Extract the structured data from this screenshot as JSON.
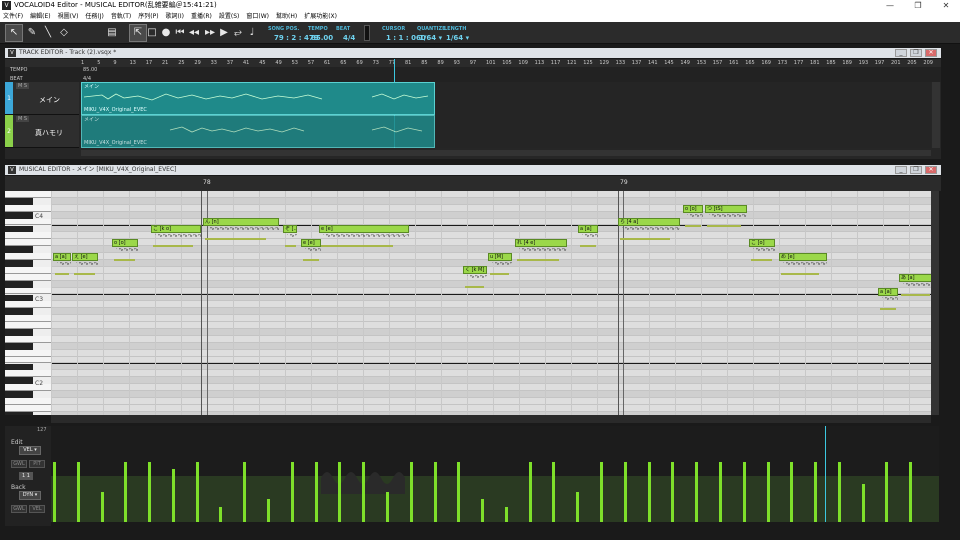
{
  "window": {
    "title": "VOCALOID4 Editor - MUSICAL EDITOR(乱雑要編＠15:41:21)",
    "app_icon": "V",
    "controls": [
      "—",
      "❐",
      "✕"
    ]
  },
  "menu": [
    "文件(F)",
    "編輯(E)",
    "視圖(V)",
    "任務(J)",
    "音軌(T)",
    "序列(P)",
    "歌詞(I)",
    "重播(R)",
    "設置(S)",
    "窗口(W)",
    "幫助(H)",
    "扩展功能(X)"
  ],
  "toolbar": {
    "song_pos_label": "SONG POS.",
    "song_pos_value": "79 : 2 : 479",
    "tempo_label": "TEMPO",
    "tempo_value": "85.00",
    "beat_label": "BEAT",
    "beat_value": "4/4",
    "cursor_label": "CURSOR",
    "cursor_value": "1 : 1 : 060",
    "quantize_label": "QUANTIZE",
    "quantize_value": "1/64 ▾",
    "length_label": "LENGTH",
    "length_value": "1/64 ▾"
  },
  "track_editor": {
    "title": "TRACK EDITOR - Track (2).vsqx *",
    "tempo_label": "TEMPO",
    "beat_label": "BEAT",
    "tempo_value": "85.00",
    "beat_value": "4/4",
    "ruler_ticks": [
      "1",
      "5",
      "9",
      "13",
      "17",
      "21",
      "25",
      "29",
      "33",
      "37",
      "41",
      "45",
      "49",
      "53",
      "57",
      "61",
      "65",
      "69",
      "73",
      "77",
      "81",
      "85",
      "89",
      "93",
      "97",
      "101",
      "105",
      "109",
      "113",
      "117",
      "121",
      "125",
      "129",
      "133",
      "137",
      "141",
      "145",
      "149",
      "153",
      "157",
      "161",
      "165",
      "169",
      "173",
      "177",
      "181",
      "185",
      "189",
      "193",
      "197",
      "201",
      "205",
      "209"
    ],
    "tracks": [
      {
        "num": "1",
        "tag": "M S",
        "name": "メイン",
        "part_name": "メイン",
        "singer": "MIKU_V4X_Original_EVEC"
      },
      {
        "num": "2",
        "tag": "M S",
        "name": "真ハモリ",
        "part_name": "メイン",
        "singer": "MIKU_V4X_Original_EVEC"
      }
    ]
  },
  "musical_editor": {
    "title": "MUSICAL EDITOR - メイン [MIKU_V4X_Original_EVEC]",
    "measure_78": "78",
    "measure_79": "79",
    "key_labels": [
      "C4",
      "C3",
      "C2"
    ],
    "notes": [
      {
        "lyric": "a [a]"
      },
      {
        "lyric": "え [e]"
      },
      {
        "lyric": "o [o]"
      },
      {
        "lyric": "こ [k o]"
      },
      {
        "lyric": "ん [n]"
      },
      {
        "lyric": "ぞ [..."
      },
      {
        "lyric": "e [e]"
      },
      {
        "lyric": "e [e]"
      },
      {
        "lyric": "く [k M]"
      },
      {
        "lyric": "u [M]"
      },
      {
        "lyric": "れ [4 e]"
      },
      {
        "lyric": "a [a]"
      },
      {
        "lyric": "ら [4 a]"
      },
      {
        "lyric": "o [o]"
      },
      {
        "lyric": "つ [tS]"
      },
      {
        "lyric": "こ [o]"
      },
      {
        "lyric": "め [e]"
      },
      {
        "lyric": "a [a]"
      },
      {
        "lyric": "あ [a]"
      }
    ],
    "control": {
      "max_label": "127",
      "edit_label": "Edit",
      "edit_param": "VEL ▾",
      "back_label": "Back",
      "back_param": "DYN ▾",
      "btn_gwl": "GWL",
      "btn_pit": "PIT",
      "btn_gwl2": "GWL",
      "btn_vel": "VEL",
      "mini_btn": "1 1",
      "velocities": [
        80,
        80,
        40,
        80,
        80,
        70,
        80,
        20,
        80,
        30,
        80,
        80,
        80,
        80,
        40,
        80,
        80,
        80,
        30,
        20,
        80,
        80,
        40,
        80,
        80,
        80,
        80,
        80,
        80,
        80,
        80,
        80,
        80,
        80,
        50,
        80,
        80
      ]
    }
  }
}
